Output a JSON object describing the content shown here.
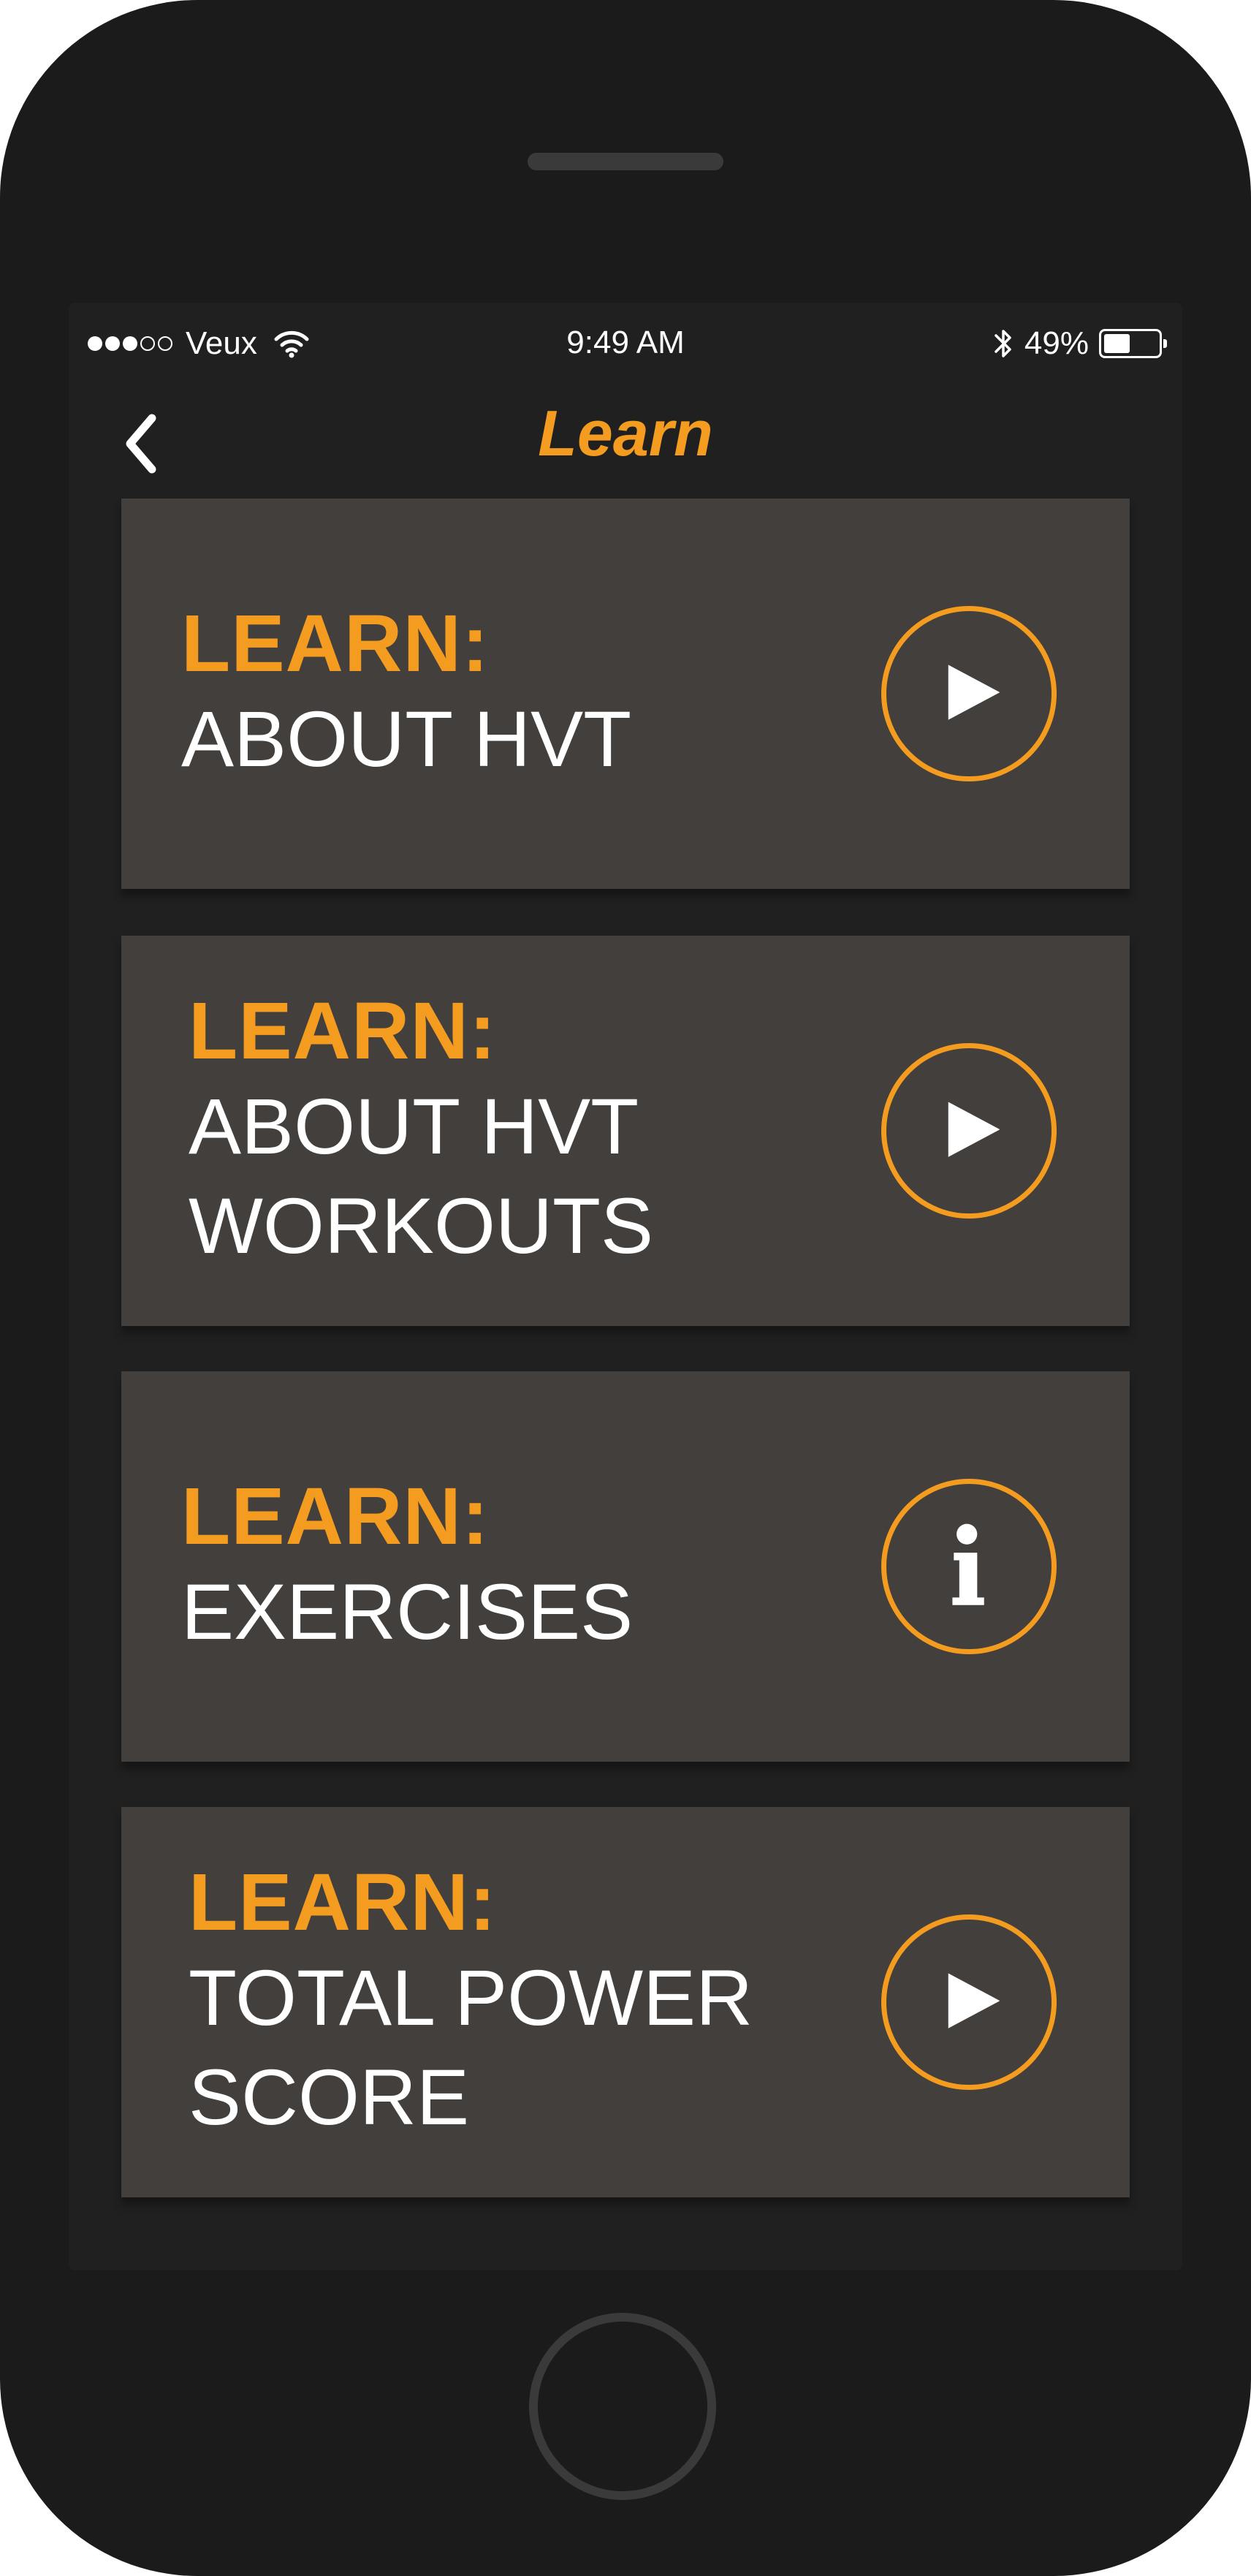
{
  "status_bar": {
    "carrier": "Veux",
    "signal_bars_filled": 3,
    "signal_bars_total": 5,
    "time": "9:49 AM",
    "battery_percent": "49%",
    "battery_level": 0.49
  },
  "nav": {
    "title": "Learn",
    "back_icon": "chevron-left-icon"
  },
  "accent_color": "#f39c1f",
  "cards": [
    {
      "label": "LEARN:",
      "title": "ABOUT HVT",
      "icon": "play-icon"
    },
    {
      "label": "LEARN:",
      "title": "ABOUT HVT\nWORKOUTS",
      "icon": "play-icon"
    },
    {
      "label": "LEARN:",
      "title": "EXERCISES",
      "icon": "info-icon"
    },
    {
      "label": "LEARN:",
      "title": "TOTAL POWER\nSCORE",
      "icon": "play-icon"
    }
  ]
}
